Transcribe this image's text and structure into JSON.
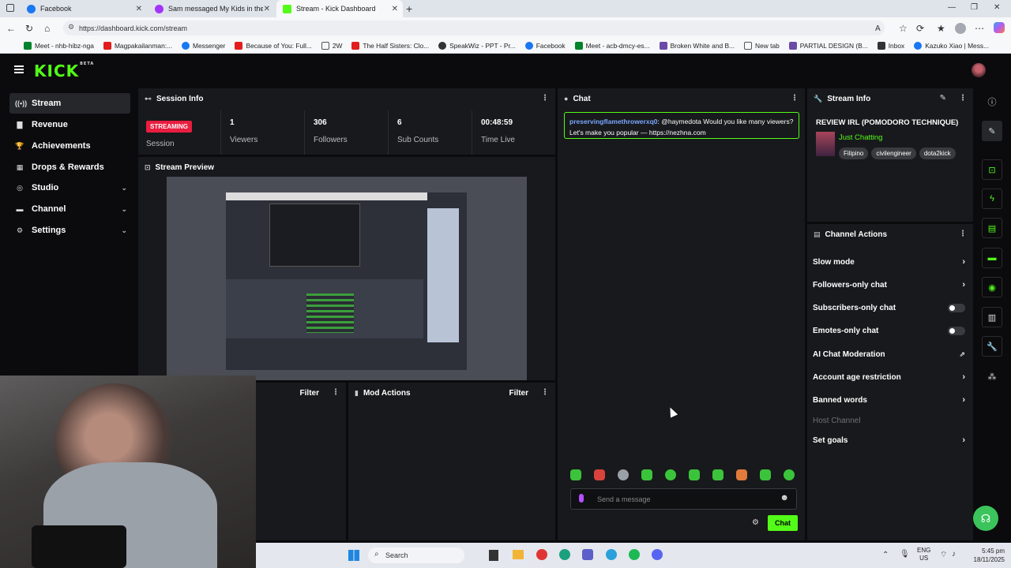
{
  "browser": {
    "tabs": [
      {
        "title": "Facebook",
        "color": "#1877f2"
      },
      {
        "title": "Sam messaged My Kids in the Ho",
        "color": "#a334fa"
      },
      {
        "title": "Stream - Kick Dashboard",
        "color": "#53fc18"
      }
    ],
    "url": "https://dashboard.kick.com/stream",
    "bookmarks": [
      "Meet - nhb-hibz-nga",
      "Magpakailanman:...",
      "Messenger",
      "Because of You: Full...",
      "2W",
      "The Half Sisters: Clo...",
      "SpeakWiz - PPT - Pr...",
      "Facebook",
      "Meet - acb-dmcy-es...",
      "Broken White and B...",
      "New tab",
      "PARTIAL DESIGN (B...",
      "Inbox",
      "Kazuko Xiao | Mess..."
    ]
  },
  "app": {
    "logo": "KICK",
    "logo_badge": "BETA",
    "sidebar": [
      {
        "label": "Stream",
        "active": true
      },
      {
        "label": "Revenue"
      },
      {
        "label": "Achievements"
      },
      {
        "label": "Drops & Rewards"
      },
      {
        "label": "Studio",
        "expandable": true
      },
      {
        "label": "Channel",
        "expandable": true
      },
      {
        "label": "Settings",
        "expandable": true
      }
    ],
    "session_info": {
      "title": "Session Info",
      "status": "STREAMING",
      "status_label": "Session",
      "stats": [
        {
          "value": "1",
          "label": "Viewers"
        },
        {
          "value": "306",
          "label": "Followers"
        },
        {
          "value": "6",
          "label": "Sub Counts"
        },
        {
          "value": "00:48:59",
          "label": "Time Live"
        }
      ]
    },
    "stream_preview": {
      "title": "Stream Preview"
    },
    "bottom_left": {
      "filter": "Filter"
    },
    "mod_actions": {
      "title": "Mod Actions",
      "filter": "Filter"
    },
    "chat": {
      "title": "Chat",
      "message_user": "preservingflamethrowerxq0",
      "message_text": ": @haymedota Would you like many viewers? Let's make you popular — https://nezhna.com",
      "input_placeholder": "Send a message",
      "send_label": "Chat"
    },
    "stream_info": {
      "title": "Stream Info",
      "stream_title": "REVIEW IRL (POMODORO TECHNIQUE)",
      "category": "Just Chatting",
      "tags": [
        "Filipino",
        "civilengineer",
        "dota2kick"
      ]
    },
    "channel_actions": {
      "title": "Channel Actions",
      "items": [
        {
          "label": "Slow mode",
          "control": "arrow"
        },
        {
          "label": "Followers-only chat",
          "control": "arrow"
        },
        {
          "label": "Subscribers-only chat",
          "control": "toggle"
        },
        {
          "label": "Emotes-only chat",
          "control": "toggle"
        },
        {
          "label": "AI Chat Moderation",
          "control": "external"
        },
        {
          "label": "Account age restriction",
          "control": "arrow"
        },
        {
          "label": "Banned words",
          "control": "arrow"
        },
        {
          "label": "Host Channel",
          "control": "none",
          "disabled": true
        },
        {
          "label": "Set goals",
          "control": "arrow"
        }
      ]
    }
  },
  "taskbar": {
    "search": "Search",
    "lang": "ENG",
    "region": "US",
    "time": "5:45 pm",
    "date": "18/11/2025"
  },
  "colors": {
    "accent": "#53fc18",
    "live": "#e91d3f",
    "panel": "#18191c"
  }
}
